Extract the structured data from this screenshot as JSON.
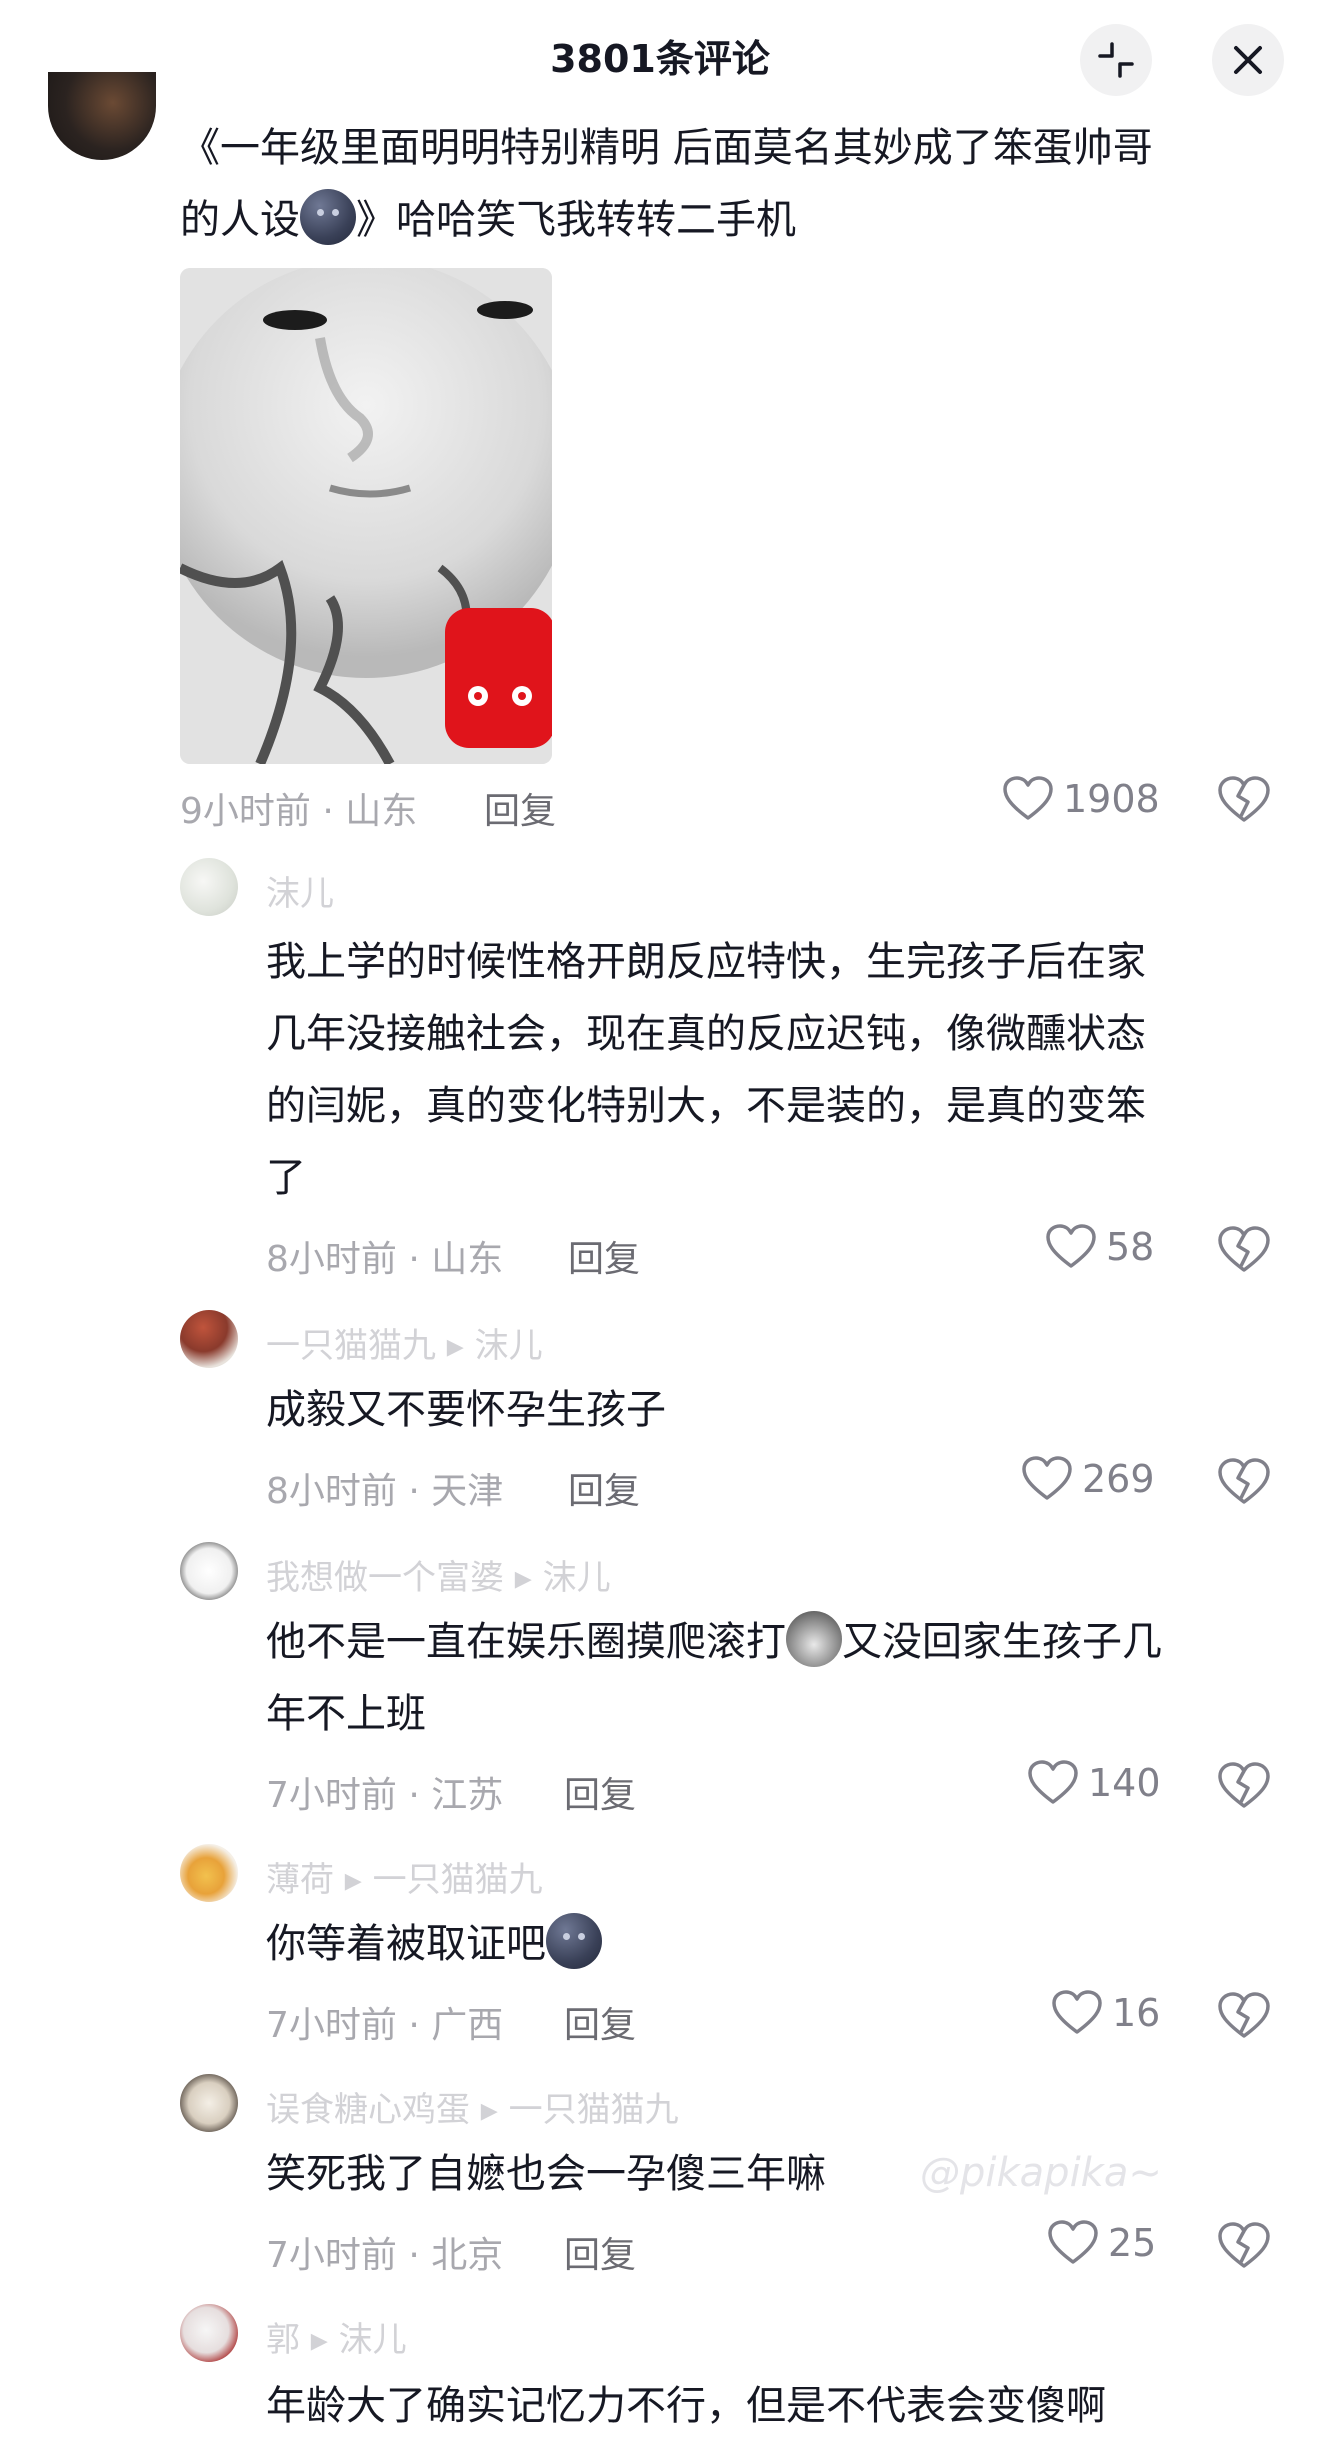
{
  "header": {
    "title": "3801条评论"
  },
  "main_comment": {
    "text_line1": "《一年级里面明明特别精明 后面莫名其妙成了笨蛋帅哥",
    "text_line2_a": "的人设",
    "text_line2_b": "》哈哈笑飞我转转二手机",
    "meta": "9小时前 · 山东",
    "reply_label": "回复",
    "likes": "1908"
  },
  "replies": [
    {
      "name": "沫儿",
      "lines": [
        "我上学的时候性格开朗反应特快，生完孩子后在家",
        "几年没接触社会，现在真的反应迟钝，像微醺状态",
        "的闫妮，真的变化特别大，不是装的，是真的变笨",
        "了"
      ],
      "meta": "8小时前 · 山东",
      "reply_label": "回复",
      "likes": "58"
    },
    {
      "name": "一只猫猫九 ▸ 沫儿",
      "lines": [
        "成毅又不要怀孕生孩子"
      ],
      "meta": "8小时前 · 天津",
      "reply_label": "回复",
      "likes": "269"
    },
    {
      "name": "我想做一个富婆 ▸ 沫儿",
      "line1_a": "他不是一直在娱乐圈摸爬滚打",
      "line1_b": "又没回家生孩子几",
      "line2": "年不上班",
      "meta": "7小时前 · 江苏",
      "reply_label": "回复",
      "likes": "140"
    },
    {
      "name": "薄荷 ▸ 一只猫猫九",
      "text": "你等着被取证吧",
      "meta": "7小时前 · 广西",
      "reply_label": "回复",
      "likes": "16"
    },
    {
      "name": "误食糖心鸡蛋 ▸ 一只猫猫九",
      "lines": [
        "笑死我了自嬷也会一孕傻三年嘛"
      ],
      "meta": "7小时前 · 北京",
      "reply_label": "回复",
      "likes": "25"
    },
    {
      "name": "郭 ▸ 沫儿",
      "lines": [
        "年龄大了确实记忆力不行，但是不代表会变傻啊"
      ]
    }
  ],
  "watermark": "@pikapika~",
  "colors": {
    "text": "#161823",
    "meta": "#a8a8ae",
    "like_icon": "#80808a",
    "button_bg": "#f1f1f2",
    "sticker_red": "#e0141b"
  }
}
